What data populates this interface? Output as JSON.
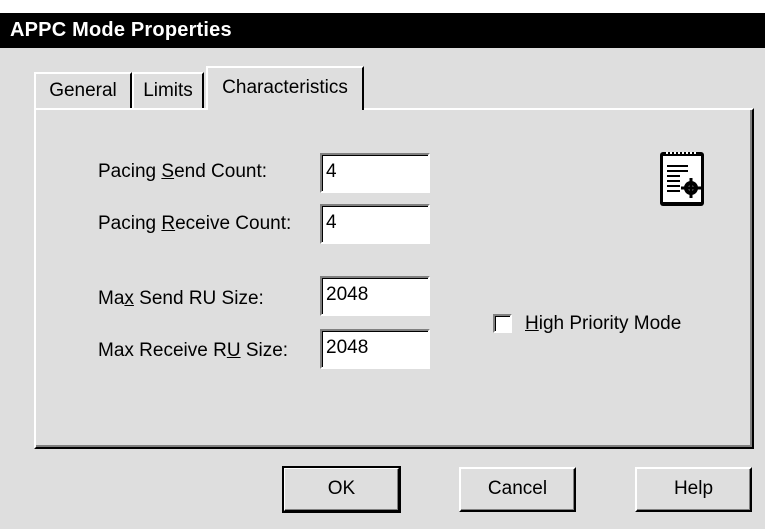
{
  "window": {
    "title": "APPC Mode Properties"
  },
  "tabs": [
    {
      "label": "General",
      "active": false
    },
    {
      "label": "Limits",
      "active": false
    },
    {
      "label": "Characteristics",
      "active": true
    }
  ],
  "fields": {
    "pacing_send": {
      "label_pre": "Pacing ",
      "label_mn": "S",
      "label_post": "end Count:",
      "value": "4"
    },
    "pacing_receive": {
      "label_pre": "Pacing ",
      "label_mn": "R",
      "label_post": "eceive Count:",
      "value": "4"
    },
    "max_send_ru": {
      "label_pre": "Ma",
      "label_mn": "x",
      "label_post": " Send RU Size:",
      "value": "2048"
    },
    "max_receive_ru": {
      "label_pre": "Max Receive R",
      "label_mn": "U",
      "label_post": " Size:",
      "value": "2048"
    }
  },
  "checkbox": {
    "label_mn": "H",
    "label_post": "igh Priority Mode",
    "checked": false
  },
  "buttons": {
    "ok": "OK",
    "cancel": "Cancel",
    "help": "Help"
  },
  "icons": {
    "properties": "document-properties-icon"
  }
}
